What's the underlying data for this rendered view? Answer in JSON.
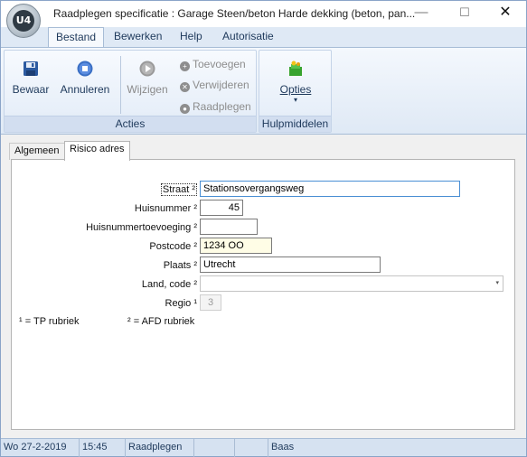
{
  "window": {
    "title": "Raadplegen specificatie : Garage Steen/beton Harde dekking (beton, pan...",
    "logo_text": "U4",
    "controls": {
      "minimize": "—",
      "maximize": "☐",
      "close": "✕"
    }
  },
  "menu": {
    "tabs": [
      "Bestand",
      "Bewerken",
      "Help",
      "Autorisatie"
    ],
    "active": "Bestand"
  },
  "ribbon": {
    "acties": {
      "label": "Acties",
      "bewaar": "Bewaar",
      "annuleren": "Annuleren",
      "wijzigen": "Wijzigen",
      "toevoegen": "Toevoegen",
      "verwijderen": "Verwijderen",
      "raadplegen": "Raadplegen"
    },
    "hulpmiddelen": {
      "label": "Hulpmiddelen",
      "opties": "Opties",
      "opties_arrow": "▾"
    }
  },
  "tabs": [
    "Algemeen",
    "Risico adres"
  ],
  "active_tab": "Risico adres",
  "form": {
    "straat": {
      "label": "Straat ²",
      "value": "Stationsovergangsweg"
    },
    "huisnummer": {
      "label": "Huisnummer ²",
      "value": "45"
    },
    "toevoeging": {
      "label": "Huisnummertoevoeging ²",
      "value": ""
    },
    "postcode": {
      "label": "Postcode ²",
      "value": "1234 OO"
    },
    "plaats": {
      "label": "Plaats ²",
      "value": "Utrecht"
    },
    "land": {
      "label": "Land, code ²",
      "value": "",
      "arrow": "▾"
    },
    "regio": {
      "label": "Regio ¹",
      "value": "3"
    }
  },
  "notes": {
    "tp": "¹ = TP rubriek",
    "afd": "² = AFD rubriek"
  },
  "status": {
    "date": "Wo  27-2-2019",
    "time": "15:45",
    "mode": "Raadplegen",
    "empty1": "",
    "empty2": "",
    "user": "Baas"
  },
  "colors": {
    "ribbon_text": "#1e395b",
    "highlight_field": "#fffde6",
    "focus_border": "#4a8fd4"
  }
}
